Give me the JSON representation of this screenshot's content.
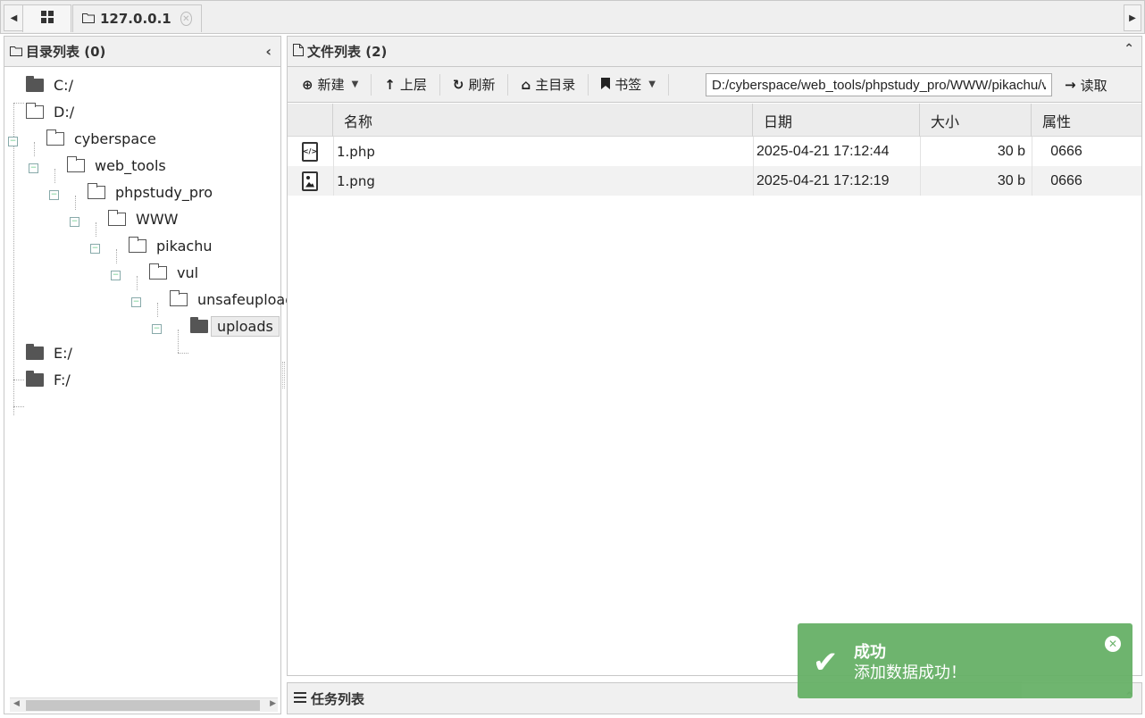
{
  "tabs": {
    "home_icon": "grid-icon",
    "active_host": "127.0.0.1"
  },
  "directory_panel": {
    "title": "目录列表 (0)",
    "tree": [
      {
        "label": "C:/"
      },
      {
        "label": "D:/"
      },
      {
        "label": "cyberspace"
      },
      {
        "label": "web_tools"
      },
      {
        "label": "phpstudy_pro"
      },
      {
        "label": "WWW"
      },
      {
        "label": "pikachu"
      },
      {
        "label": "vul"
      },
      {
        "label": "unsafeupload"
      },
      {
        "label": "uploads"
      },
      {
        "label": "E:/"
      },
      {
        "label": "F:/"
      }
    ]
  },
  "file_panel": {
    "title": "文件列表 (2)",
    "toolbar": {
      "new_label": "新建",
      "up_label": "上层",
      "refresh_label": "刷新",
      "home_label": "主目录",
      "bookmark_label": "书签",
      "path_value": "D:/cyberspace/web_tools/phpstudy_pro/WWW/pikachu/vul/unsafeupload/uploads/",
      "read_label": "读取"
    },
    "columns": [
      "名称",
      "日期",
      "大小",
      "属性"
    ],
    "rows": [
      {
        "icon": "php-file-icon",
        "name": "1.php",
        "date": "2025-04-21 17:12:44",
        "size": "30 b",
        "attr": "0666"
      },
      {
        "icon": "image-file-icon",
        "name": "1.png",
        "date": "2025-04-21 17:12:19",
        "size": "30 b",
        "attr": "0666"
      }
    ]
  },
  "task_panel": {
    "title": "任务列表"
  },
  "toast": {
    "title": "成功",
    "message": "添加数据成功！",
    "color": "#67b167"
  }
}
